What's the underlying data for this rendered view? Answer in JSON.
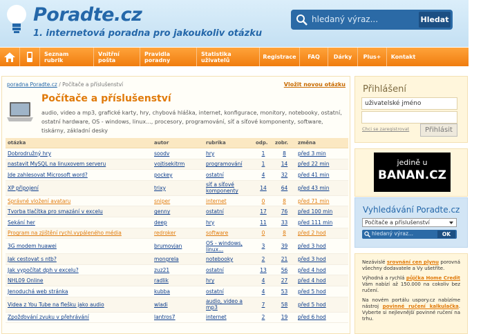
{
  "header": {
    "logo": "Poradte.cz",
    "tagline": "1. internetová poradna pro jakoukoliv otázku",
    "search_placeholder": "hledaný výraz...",
    "search_button": "Hledat"
  },
  "nav": {
    "items": [
      "Seznam rubrik",
      "Vnitřní pošta",
      "Pravidla poradny",
      "Statistika uživatelů",
      "Registrace",
      "FAQ",
      "Dárky",
      "Plus+",
      "Kontakt"
    ]
  },
  "breadcrumb": {
    "home": "poradna Poradte.cz",
    "current": "Počítače a příslušenství"
  },
  "new_question": "Vložit novou otázku",
  "category": {
    "title": "Počítače a příslušenství",
    "description": "audio, video a mp3, grafické karty, hry, chybová hláška, internet, konfigurace, monitory, notebooky, ostatní, ostatní hardware, OS - windows, linux..., procesory, programování, síť a síťové komponenty, software, tiskárny, základní desky"
  },
  "table": {
    "headers": [
      "otázka",
      "autor",
      "rubrika",
      "odp.",
      "zobr.",
      "změna"
    ],
    "rows": [
      [
        "Dobrodružný hry",
        "soodv",
        "hry",
        "1",
        "8",
        "před 3 min"
      ],
      [
        "nastavit MySQL na linuxovem serveru",
        "vojtisekitrm",
        "programování",
        "1",
        "14",
        "před 22 min"
      ],
      [
        "Jde zahlesovat Microsoft word?",
        "pockey",
        "ostatní",
        "4",
        "32",
        "před 41 min"
      ],
      [
        "XP připojení",
        "trixy",
        "síť a síťové komponenty",
        "14",
        "64",
        "před 43 min"
      ],
      [
        "Správné vložení avataru",
        "sniper",
        "internet",
        "0",
        "8",
        "před 71 min"
      ],
      [
        "Tvorba tlačítka pro smazání v excelu",
        "genny",
        "ostatní",
        "17",
        "76",
        "před 100 min"
      ],
      [
        "Sekání her",
        "deep",
        "hry",
        "11",
        "33",
        "před 111 min"
      ],
      [
        "Program na zjištění rychl.vypáleného média",
        "redroker",
        "software",
        "0",
        "8",
        "před 2 hod"
      ],
      [
        "3G modem huawei",
        "brumovjan",
        "OS - windows, linux...",
        "3",
        "39",
        "před 3 hod"
      ],
      [
        "Jak cestovat s ntb?",
        "mongrela",
        "notebooky",
        "2",
        "21",
        "před 3 hod"
      ],
      [
        "Jak vypočítat dph v excelu?",
        "zuz21",
        "ostatní",
        "13",
        "56",
        "před 4 hod"
      ],
      [
        "NHL09 Online",
        "radlik",
        "hry",
        "4",
        "27",
        "před 4 hod"
      ],
      [
        "Jenoduchá web stránka",
        "kubba",
        "ostatní",
        "4",
        "53",
        "před 5 hod"
      ],
      [
        "Videa z You Tube na flešku jako audio",
        "wladi",
        "audio, video a mp3",
        "7",
        "58",
        "před 5 hod"
      ],
      [
        "Zpožďování zvuku v přehrávání",
        "lantros7",
        "internet",
        "2",
        "19",
        "před 6 hod"
      ]
    ]
  },
  "login": {
    "title": "Přihlášení",
    "username": "uživatelské jméno",
    "register": "Chci se zaregistrovat",
    "button": "Přihlásit"
  },
  "banner": {
    "line1": "jedině u",
    "line2": "BANAN.CZ"
  },
  "site_search": {
    "title": "Vyhledávání Poradte.cz",
    "select": "Počítače a příslušenství",
    "placeholder": "hledaný výraz...",
    "button": "OK"
  },
  "ads": {
    "a1_pre": "Nezávislé ",
    "a1_link": "srovnání cen plynu",
    "a1_post": " porovná všechny dodavatele a Vy ušetříte.",
    "a2_pre": "Výhodná a rychlá ",
    "a2_link": "půjčka Home Credit",
    "a2_post": " Vám nabízí až 150.000 na cokoliv bez ručení.",
    "a3_pre": "Na novém portálu uspory.cz nabízíme nástroj ",
    "a3_link": "povinné ručení kalkulačka",
    "a3_post": ". Vyberte si nejlevnější povinné ručení na trhu."
  }
}
